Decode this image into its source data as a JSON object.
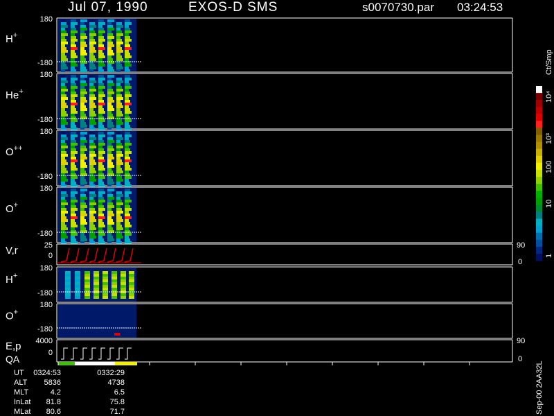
{
  "header": {
    "date": "Jul 07, 1990",
    "instrument": "EXOS-D SMS",
    "file": "s0070730.par",
    "time": "03:24:53"
  },
  "panels": [
    {
      "id": "h_plus",
      "label_main": "H",
      "label_sup": "+",
      "tick_top": "180",
      "tick_bottom": "-180"
    },
    {
      "id": "he_plus",
      "label_main": "He",
      "label_sup": "+",
      "tick_top": "180",
      "tick_bottom": "-180"
    },
    {
      "id": "o_plusplus",
      "label_main": "O",
      "label_sup": "++",
      "tick_top": "180",
      "tick_bottom": "-180"
    },
    {
      "id": "o_plus",
      "label_main": "O",
      "label_sup": "+",
      "tick_top": "180",
      "tick_bottom": "-180"
    },
    {
      "id": "vr",
      "label_main": "V,r",
      "label_sup": "",
      "tick_top": "25",
      "tick_bottom": "0",
      "right_top": "90",
      "right_bottom": "0"
    },
    {
      "id": "h_plus_2",
      "label_main": "H",
      "label_sup": "+",
      "tick_top": "180",
      "tick_bottom": "-180"
    },
    {
      "id": "o_plus_2",
      "label_main": "O",
      "label_sup": "+",
      "tick_top": "180",
      "tick_bottom": "-180"
    },
    {
      "id": "ep",
      "label_main": "E,p",
      "label_sub2": "QA",
      "label_sup": "",
      "tick_top": "4000",
      "tick_bottom": "0",
      "right_top": "90",
      "right_bottom": "0"
    }
  ],
  "colorbar": {
    "title": "Ct/Smp",
    "labels": [
      "10⁴",
      "10³",
      "100",
      "10",
      "1"
    ],
    "colors": [
      "#ffffff",
      "#7a0000",
      "#a00000",
      "#c00000",
      "#e00000",
      "#ff2020",
      "#806000",
      "#9a7a00",
      "#b09000",
      "#c8b000",
      "#e0d000",
      "#f0f000",
      "#c8e000",
      "#90d000",
      "#40c000",
      "#00b000",
      "#00a000",
      "#008a30",
      "#008080",
      "#00b0c0",
      "#00a0d0",
      "#0070b0",
      "#0050a0",
      "#002880",
      "#001060"
    ]
  },
  "footer": {
    "rows": [
      {
        "label": "UT",
        "v1": "0324:53",
        "v2": "0332:29"
      },
      {
        "label": "ALT",
        "v1": "5836",
        "v2": "4738"
      },
      {
        "label": "MLT",
        "v1": "4.2",
        "v2": "6.5"
      },
      {
        "label": "InLat",
        "v1": "81.8",
        "v2": "75.8"
      },
      {
        "label": "MLat",
        "v1": "80.6",
        "v2": "71.7"
      }
    ],
    "side_label": "Sep-00 2AA32L"
  },
  "chart_data": {
    "type": "heatmap",
    "x_range": [
      "0324:53",
      "0332:29"
    ],
    "series": [
      {
        "name": "H+",
        "band_count": 8
      },
      {
        "name": "He+",
        "band_count": 8
      },
      {
        "name": "O++",
        "band_count": 8
      },
      {
        "name": "O+",
        "band_count": 8
      },
      {
        "name": "V,r",
        "band_count": 8
      },
      {
        "name": "H+",
        "band_count": 8
      },
      {
        "name": "O+",
        "band_count": 0
      },
      {
        "name": "E,p",
        "band_count": 8
      }
    ],
    "colorscale": "log",
    "colorscale_range": [
      1,
      10000
    ],
    "grid": false
  }
}
